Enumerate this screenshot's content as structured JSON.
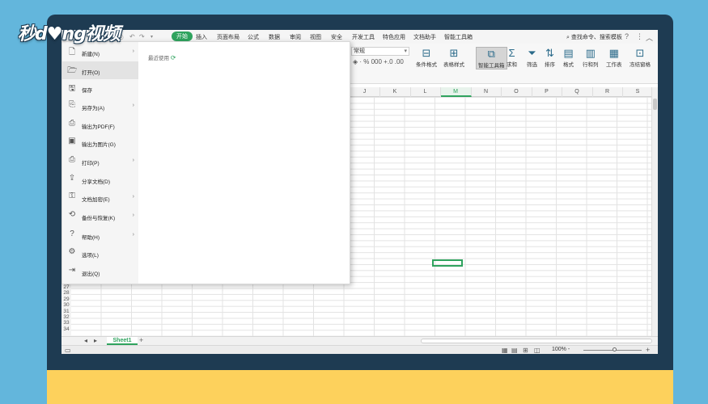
{
  "watermark": {
    "logo_text": "秒d♥ng视频"
  },
  "menubar": {
    "tabs": [
      "开始",
      "插入",
      "页面布局",
      "公式",
      "数据",
      "审阅",
      "视图",
      "安全",
      "开发工具",
      "特色应用",
      "文档助手",
      "智能工具箱"
    ],
    "active_tab": "开始",
    "search_placeholder": "查找命令、搜索模板"
  },
  "ribbon": {
    "number_format": "常规",
    "number_icons": "◈ · % 000 +.0 .00",
    "buttons": [
      {
        "label": "条件格式",
        "icon": "table-icon"
      },
      {
        "label": "表格样式",
        "icon": "table-style-icon"
      },
      {
        "label": "智能工具箱",
        "icon": "toolbox-icon"
      },
      {
        "label": "求和",
        "icon": "sigma-icon"
      },
      {
        "label": "筛选",
        "icon": "filter-icon"
      },
      {
        "label": "排序",
        "icon": "sort-icon"
      },
      {
        "label": "格式",
        "icon": "format-icon"
      },
      {
        "label": "行和列",
        "icon": "rows-cols-icon"
      },
      {
        "label": "工作表",
        "icon": "worksheet-icon"
      },
      {
        "label": "冻结窗格",
        "icon": "freeze-icon"
      }
    ]
  },
  "grid": {
    "columns": [
      "J",
      "K",
      "L",
      "M",
      "N",
      "O",
      "P",
      "Q",
      "R",
      "S"
    ],
    "selected_column": "M",
    "visible_rows": [
      "27",
      "28",
      "29",
      "30",
      "31",
      "32",
      "33",
      "34"
    ]
  },
  "file_menu": {
    "items": [
      {
        "label": "新建(N)",
        "icon": "new-file-icon",
        "has_submenu": true
      },
      {
        "label": "打开(O)",
        "icon": "open-folder-icon",
        "has_submenu": false,
        "active": true
      },
      {
        "label": "保存",
        "icon": "save-icon",
        "has_submenu": false
      },
      {
        "label": "另存为(A)",
        "icon": "save-as-icon",
        "has_submenu": true
      },
      {
        "label": "输出为PDF(F)",
        "icon": "pdf-icon",
        "has_submenu": false
      },
      {
        "label": "输出为图片(G)",
        "icon": "image-export-icon",
        "has_submenu": false
      },
      {
        "label": "打印(P)",
        "icon": "print-icon",
        "has_submenu": true
      },
      {
        "label": "分享文档(D)",
        "icon": "share-icon",
        "has_submenu": false
      },
      {
        "label": "文档加密(E)",
        "icon": "encrypt-icon",
        "has_submenu": true
      },
      {
        "label": "备份与恢复(K)",
        "icon": "backup-icon",
        "has_submenu": true
      },
      {
        "label": "帮助(H)",
        "icon": "help-icon",
        "has_submenu": true
      },
      {
        "label": "选项(L)",
        "icon": "options-icon",
        "has_submenu": false
      },
      {
        "label": "退出(Q)",
        "icon": "exit-icon",
        "has_submenu": false
      }
    ],
    "recent_label": "最近使用"
  },
  "sheetbar": {
    "active_sheet": "Sheet1"
  },
  "statusbar": {
    "zoom": "100%"
  }
}
